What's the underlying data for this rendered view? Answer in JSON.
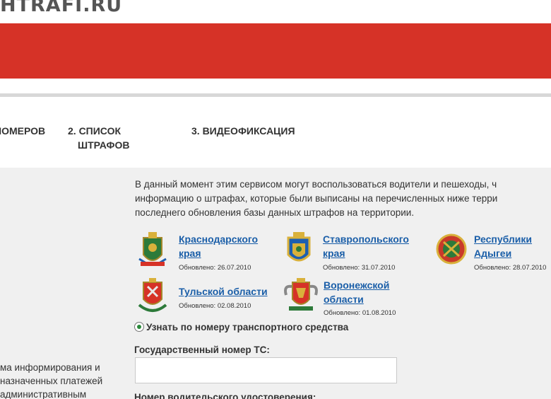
{
  "header": {
    "logo_text": "HTRAFI.RU"
  },
  "tabs": [
    {
      "label": "НОМЕРОВ"
    },
    {
      "label_line1": "2. СПИСОК",
      "label_line2": "ШТРАФОВ"
    },
    {
      "label": "3. ВИДЕОФИКСАЦИЯ"
    }
  ],
  "intro": {
    "line1": "В данный момент этим сервисом могут воспользоваться водители и пешеходы, ч",
    "line2": "информацию о штрафах, которые были выписаны на перечисленных ниже терри",
    "line3": "последнего обновления базы данных штрафов на территории."
  },
  "regions": [
    {
      "name_line1": "Краснодарского",
      "name_line2": "края",
      "updated": "Обновлено: 26.07.2010"
    },
    {
      "name_line1": "Ставропольского",
      "name_line2": "края",
      "updated": "Обновлено: 31.07.2010"
    },
    {
      "name_line1": "Республики",
      "name_line2": "Адыгеи",
      "updated": "Обновлено: 28.07.2010"
    },
    {
      "name_line1": "Тульской области",
      "name_line2": "",
      "updated": "Обновлено: 02.08.2010"
    },
    {
      "name_line1": "Воронежской",
      "name_line2": "области",
      "updated": "Обновлено: 01.08.2010"
    }
  ],
  "search_form": {
    "radio_label": "Узнать по номеру транспортного средства",
    "plate_label": "Государственный номер ТС:",
    "plate_value": "",
    "license_label": "Номер водительского удостоверения:"
  },
  "sidebar": {
    "line1": "ма информирования и",
    "line2": "назначенных платежей",
    "line3": "административным"
  },
  "colors": {
    "brand_red": "#d63227",
    "link_blue": "#1a5ea8",
    "content_bg": "#f0f0f0"
  },
  "icons": [
    "krasnodar-emblem-icon",
    "stavropol-emblem-icon",
    "adygea-emblem-icon",
    "tula-emblem-icon",
    "voronezh-emblem-icon",
    "radio-selected-icon"
  ]
}
